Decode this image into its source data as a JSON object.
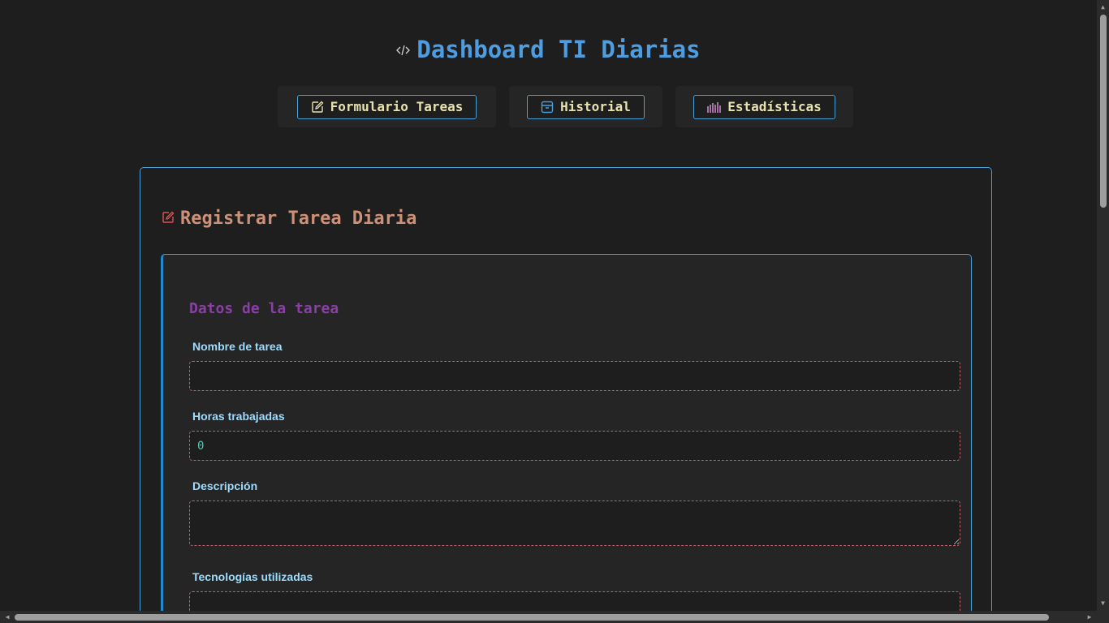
{
  "header": {
    "icon": "code-icon",
    "title": "Dashboard TI Diarias"
  },
  "nav": {
    "items": [
      {
        "label": "Formulario Tareas",
        "icon": "edit-icon",
        "color": "#e8e2b0"
      },
      {
        "label": "Historial",
        "icon": "archive-icon",
        "color": "#4a9fd8"
      },
      {
        "label": "Estadísticas",
        "icon": "bar-chart-icon",
        "color": "#c586c0"
      }
    ]
  },
  "card": {
    "icon": "edit-icon",
    "title": "Registrar Tarea Diaria",
    "section_title": "Datos de la tarea",
    "fields": {
      "task_name": {
        "label": "Nombre de tarea",
        "value": ""
      },
      "hours": {
        "label": "Horas trabajadas",
        "value": "0"
      },
      "description": {
        "label": "Descripción",
        "value": ""
      },
      "technologies": {
        "label": "Tecnologías utilizadas",
        "value": ""
      }
    }
  },
  "colors": {
    "accent": "#4a9fd8",
    "title": "#4e9de0",
    "card_title": "#ce9178",
    "section": "#8a3fa5",
    "label": "#9cdcfe",
    "field_border": "#c0606a"
  }
}
